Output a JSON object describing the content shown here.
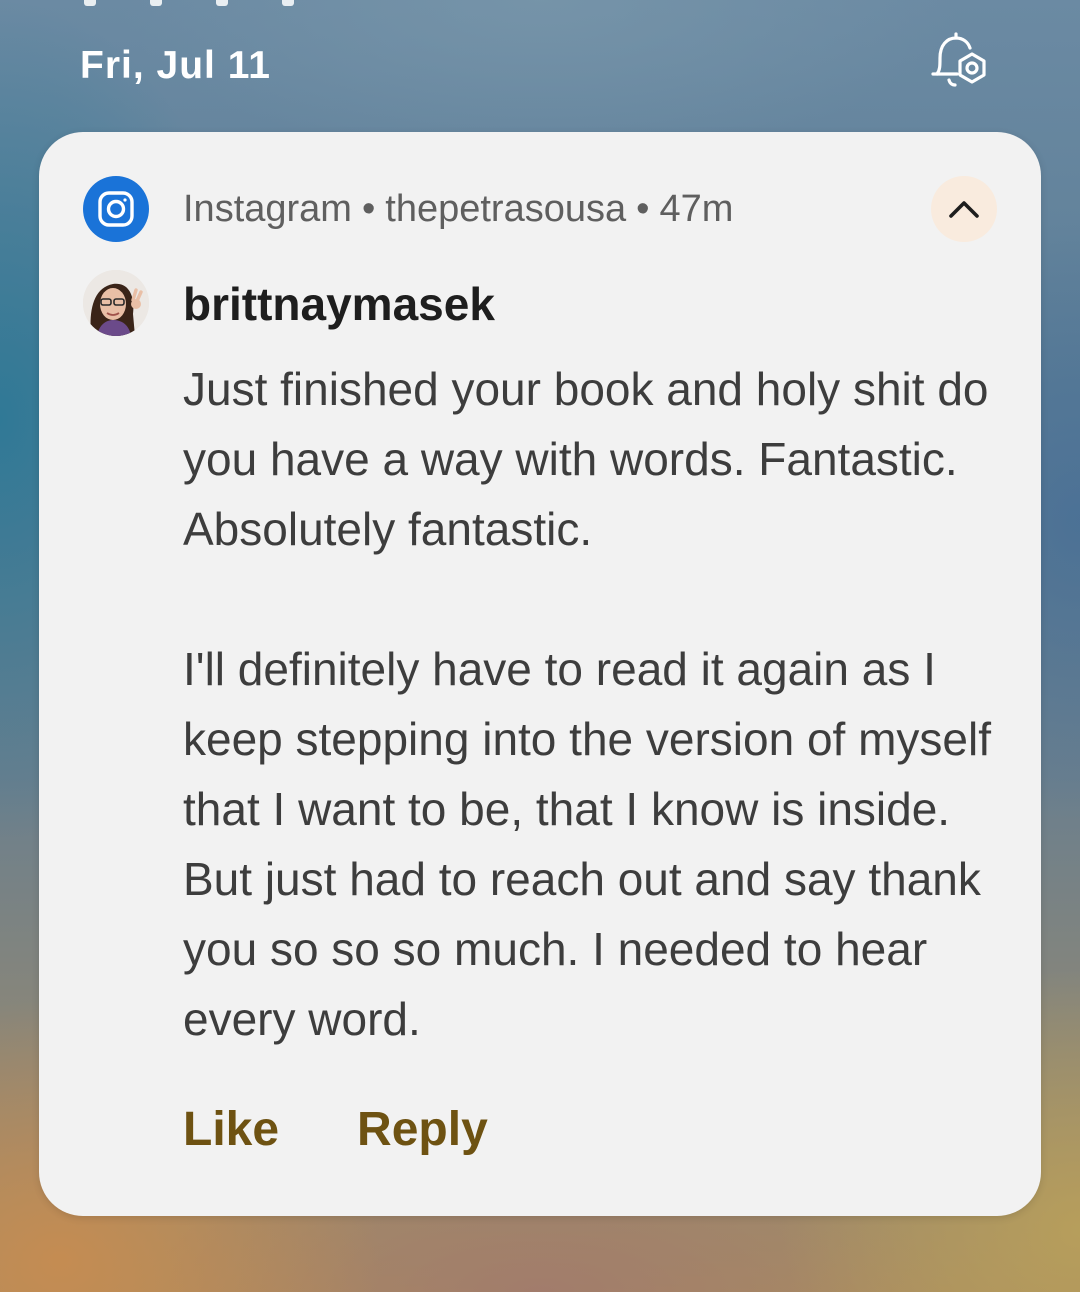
{
  "lockscreen": {
    "date": "Fri, Jul 11"
  },
  "notification": {
    "app_name": "Instagram",
    "account": "thepetrasousa",
    "time_ago": "47m",
    "separator": "•",
    "sender": "brittnaymasek",
    "message_paragraph_1": "Just finished your book and holy shit do you have a way with words. Fantastic. Absolutely fantastic.",
    "message_paragraph_2": "I'll definitely have to read it again as I keep stepping into the version of myself that I want to be, that I know is inside. But just had to reach out and say thank you so so so much. I needed to hear every word.",
    "actions": {
      "like_label": "Like",
      "reply_label": "Reply"
    }
  },
  "icons": {
    "alert_settings": "bell-gear-icon",
    "app": "instagram-icon",
    "collapse": "chevron-up-icon",
    "avatar": "user-avatar"
  },
  "colors": {
    "app_icon": "#1a73d8",
    "action_text": "#6e5212",
    "collapse_bg": "#f9ebde",
    "card_bg": "#f2f2f2"
  }
}
